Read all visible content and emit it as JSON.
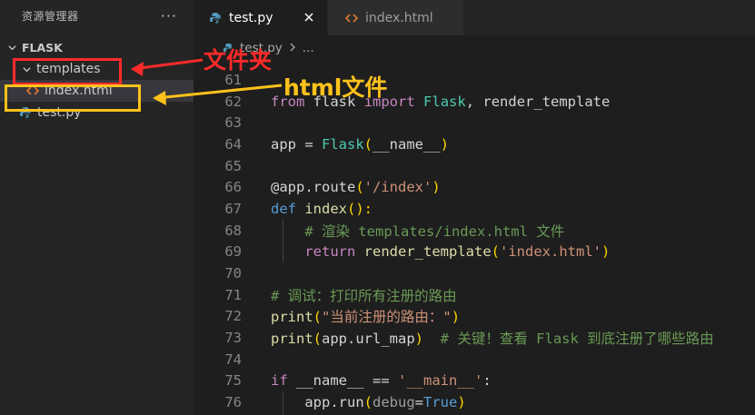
{
  "sidebar": {
    "title": "资源管理器",
    "more": "···",
    "root": "FLASK",
    "folder": "templates",
    "file_html": "index.html",
    "file_py": "test.py"
  },
  "tabs": [
    {
      "label": "test.py",
      "active": true
    },
    {
      "label": "index.html",
      "active": false
    }
  ],
  "breadcrumb": {
    "file": "test.py",
    "rest": "..."
  },
  "annotations": {
    "folder_label": "文件夹",
    "html_label": "html文件",
    "folder_color": "#ff2a2a",
    "html_color": "#ffc21a"
  },
  "code": {
    "l61": "61",
    "l62": "62",
    "l63": "63",
    "l64": "64",
    "l65": "65",
    "l66": "66",
    "l67": "67",
    "l68": "68",
    "l69": "69",
    "l70": "70",
    "l71": "71",
    "l72": "72",
    "l73": "73",
    "l74": "74",
    "l75": "75",
    "l76": "76",
    "from": "from",
    "flask": "flask",
    "import": "import",
    "Flask": "Flask",
    "comma_rt": ", render_template",
    "app_eq": "app = ",
    "Flask2": "Flask",
    "lp": "(",
    "name_arg": "__name__",
    "rp": ")",
    "decorator": "@app.route",
    "route_arg": "'/index'",
    "def": "def",
    "index_fn": "index",
    "parens_colon": "():",
    "cmt68": "# 渲染 templates/index.html 文件",
    "return": "return",
    "rt_fn": "render_template",
    "rt_arg": "'index.html'",
    "cmt71": "# 调试：打印所有注册的路由",
    "print": "print",
    "print_arg": "\"当前注册的路由：\"",
    "url_map": "app.url_map",
    "cmt73": "  # 关键！查看 Flask 到底注册了哪些路由",
    "if": "if",
    "name_cmp": " __name__ == ",
    "main_str": "'__main__'",
    "colon": ":",
    "apprun": "app.run",
    "debug": "debug",
    "eq": "=",
    "true": "True"
  }
}
